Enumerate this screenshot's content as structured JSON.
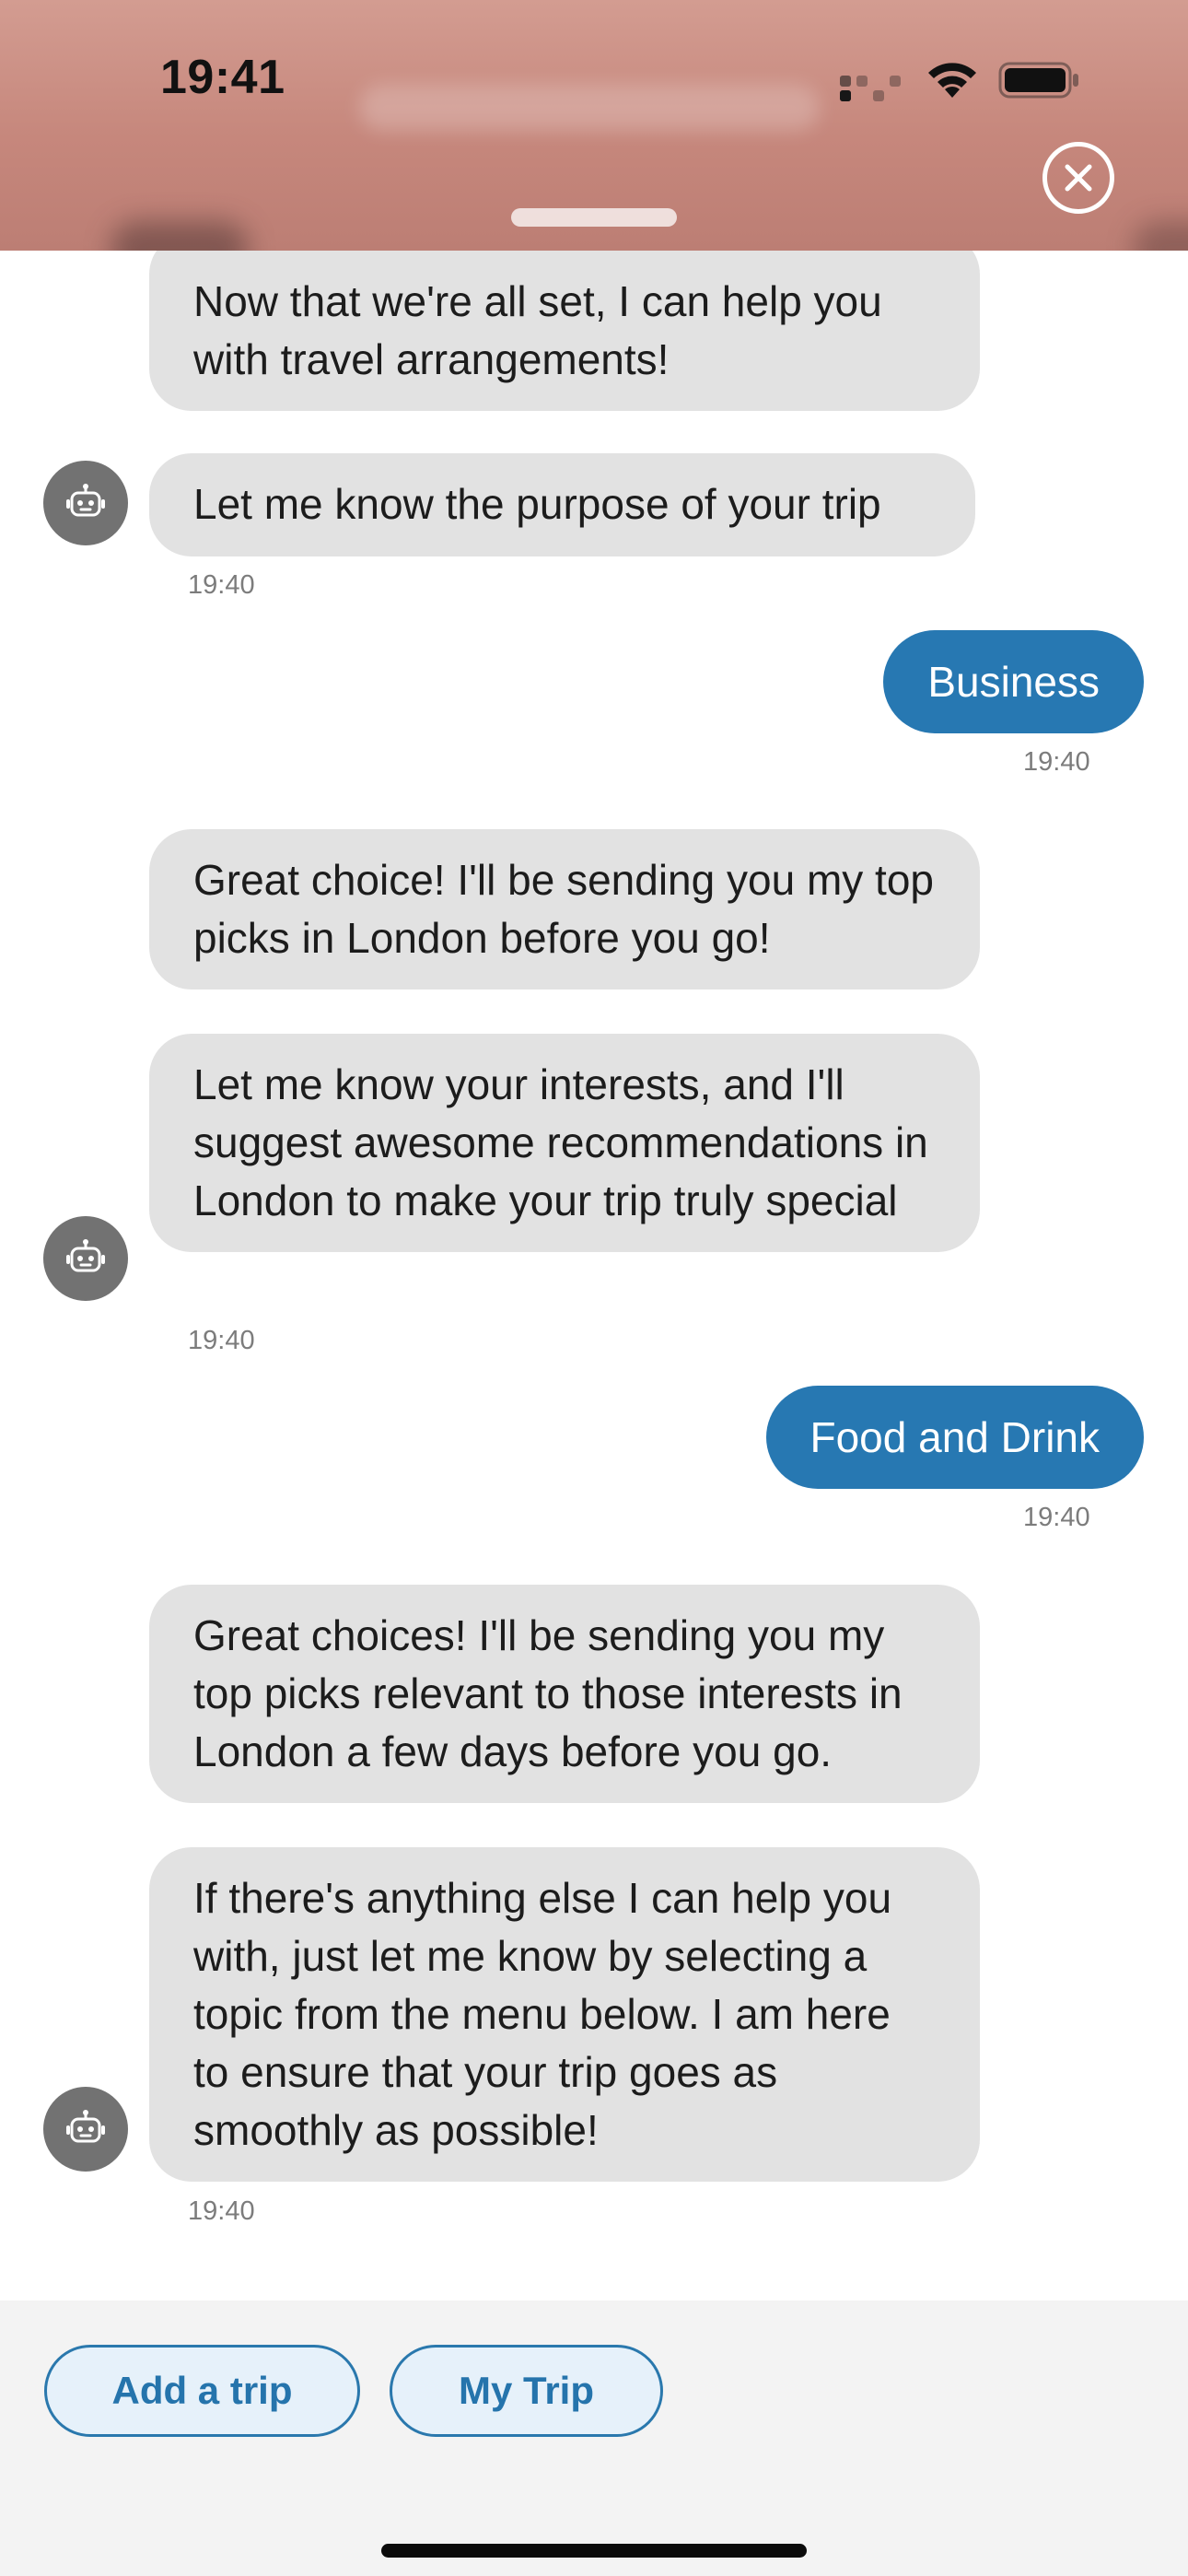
{
  "status_bar": {
    "time": "19:41",
    "icons": [
      "cellular-signal-icon",
      "wifi-icon",
      "battery-icon"
    ]
  },
  "header": {
    "close_icon": "close-icon"
  },
  "messages": [
    {
      "sender": "bot",
      "text": "Now that we're all set, I can help you with travel arrangements!"
    },
    {
      "sender": "bot",
      "text": "Let me know the purpose of your trip",
      "time": "19:40"
    },
    {
      "sender": "user",
      "text": "Business",
      "time": "19:40"
    },
    {
      "sender": "bot",
      "text": "Great choice! I'll be sending you my top picks in London before you go!"
    },
    {
      "sender": "bot",
      "text": "Let me know your interests, and I'll suggest awesome recommendations in London to make your trip truly special",
      "time": "19:40"
    },
    {
      "sender": "user",
      "text": "Food and Drink",
      "time": "19:40"
    },
    {
      "sender": "bot",
      "text": "Great choices! I'll be sending you my top picks relevant to those interests in London a few days before you go."
    },
    {
      "sender": "bot",
      "text": "If there's anything else I can help you with, just let me know by selecting a topic from the menu below. I am here to ensure that your trip goes as smoothly as possible!",
      "time": "19:40"
    }
  ],
  "quick_actions": [
    {
      "label": "Add a trip"
    },
    {
      "label": "My Trip"
    }
  ],
  "colors": {
    "user_bubble": "#2778b2",
    "bot_bubble": "#e2e2e2",
    "pill_text": "#2574ac",
    "header": "#c6877c"
  }
}
